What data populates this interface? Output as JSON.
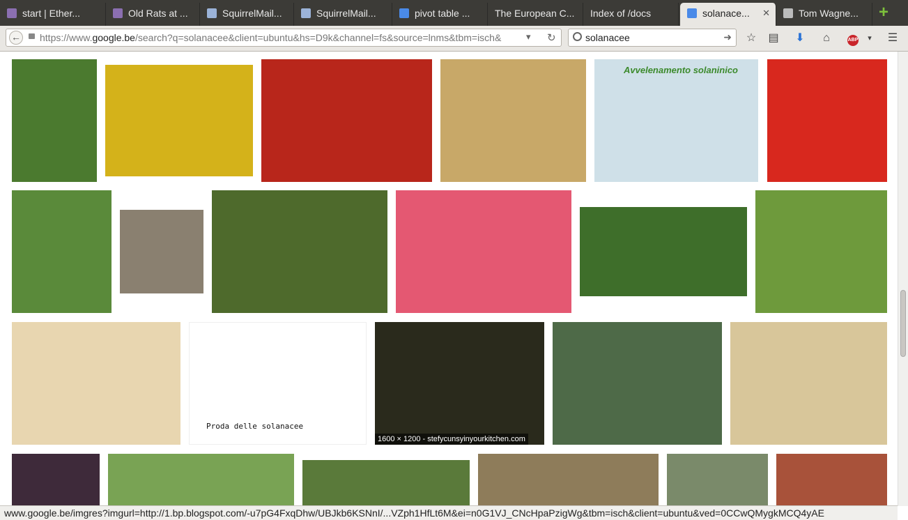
{
  "tabs": [
    {
      "label": "start | Ether...",
      "color": "#8b6fb1"
    },
    {
      "label": "Old Rats at ...",
      "color": "#8b6fb1"
    },
    {
      "label": "SquirrelMail...",
      "color": "#9bb3d8"
    },
    {
      "label": "SquirrelMail...",
      "color": "#9bb3d8"
    },
    {
      "label": "pivot table ...",
      "color": "#4a8ae8"
    },
    {
      "label": "The European C...",
      "color": ""
    },
    {
      "label": "Index of /docs",
      "color": ""
    },
    {
      "label": "solanace...",
      "color": "#4a8ae8",
      "active": true
    },
    {
      "label": "Tom Wagne...",
      "color": "#bbbbbb"
    }
  ],
  "nav": {
    "url_prefix": "https://www.",
    "url_host": "google.be",
    "url_rest": "/search?q=solanacee&client=ubuntu&hs=D9k&channel=fs&source=lnms&tbm=isch&",
    "search_query": "solanacee"
  },
  "images": [
    {
      "name": "image-plant-pot",
      "color": "#4b7a2f"
    },
    {
      "name": "image-yellow-tansy",
      "color": "#d4b21a"
    },
    {
      "name": "image-cherry-tomatoes",
      "color": "#b8261b"
    },
    {
      "name": "image-potatoes",
      "color": "#c8a868"
    },
    {
      "name": "image-solanine-poster",
      "color": "#cfe0e8"
    },
    {
      "name": "image-red-tomatoes",
      "color": "#d8281e"
    },
    {
      "name": "image-brugmansia",
      "color": "#5a8a3a"
    },
    {
      "name": "image-vintage-woman",
      "color": "#8a8070"
    },
    {
      "name": "image-orange-berries",
      "color": "#4e6a2c"
    },
    {
      "name": "image-pink-petunias",
      "color": "#e45872"
    },
    {
      "name": "image-white-flowers",
      "color": "#3e6e2a"
    },
    {
      "name": "image-poppy-field",
      "color": "#6e9a3c"
    },
    {
      "name": "image-mandrake-drawing",
      "color": "#e8d6b0"
    },
    {
      "name": "image-solanacee-diagram",
      "color": "#ffffff"
    },
    {
      "name": "image-green-dip",
      "color": "#2a2a1c"
    },
    {
      "name": "image-henbane-flower",
      "color": "#4e6a48"
    },
    {
      "name": "image-book-cover",
      "color": "#d8c69a"
    },
    {
      "name": "image-eggplant",
      "color": "#3e2a3a"
    },
    {
      "name": "image-striped-plant",
      "color": "#79a354"
    },
    {
      "name": "image-leaves",
      "color": "#5a7a3a"
    },
    {
      "name": "image-garden-structure",
      "color": "#8e7c5a"
    },
    {
      "name": "image-plant-window",
      "color": "#7a8a6a"
    },
    {
      "name": "image-physalis",
      "color": "#a8523a"
    }
  ],
  "overlays": {
    "solanine_title": "Avvelenamento solaninico",
    "diagram_caption": "Proda delle solanacee",
    "dip_caption": "1600 × 1200 - stefycunsyinyourkitchen.com"
  },
  "status_url": "www.google.be/imgres?imgurl=http://1.bp.blogspot.com/-u7pG4FxqDhw/UBJkb6KSNnI/...VZph1HfLt6M&ei=n0G1VJ_CNcHpaPzigWg&tbm=isch&client=ubuntu&ved=0CCwQMygkMCQ4yAE"
}
